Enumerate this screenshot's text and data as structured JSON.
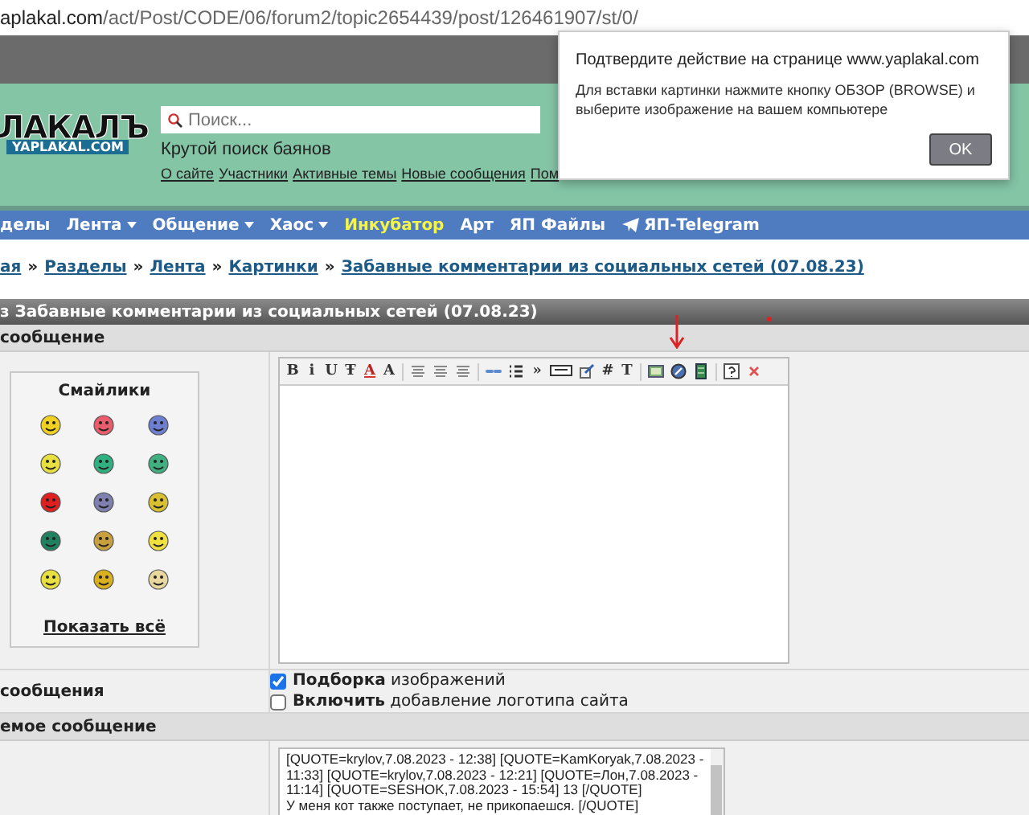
{
  "address_bar": {
    "host": "aplakal.com",
    "path": "/act/Post/CODE/06/forum2/topic2654439/post/126461907/st/0/"
  },
  "header": {
    "logo": {
      "title": "ЛАКАЛЪ",
      "domain": "YAPLAKAL.COM"
    },
    "search": {
      "placeholder": "Поиск..."
    },
    "tagline": "Крутой поиск баянов",
    "links": [
      "О сайте",
      "Участники",
      "Активные темы",
      "Новые сообщения",
      "Пом"
    ]
  },
  "nav": [
    {
      "label": "делы",
      "dropdown": false,
      "highlighted": false,
      "telegram": false
    },
    {
      "label": "Лента",
      "dropdown": true,
      "highlighted": false,
      "telegram": false
    },
    {
      "label": "Общение",
      "dropdown": true,
      "highlighted": false,
      "telegram": false
    },
    {
      "label": "Хаос",
      "dropdown": true,
      "highlighted": false,
      "telegram": false
    },
    {
      "label": "Инкубатор",
      "dropdown": false,
      "highlighted": true,
      "telegram": false
    },
    {
      "label": "Арт",
      "dropdown": false,
      "highlighted": false,
      "telegram": false
    },
    {
      "label": "ЯП Файлы",
      "dropdown": false,
      "highlighted": false,
      "telegram": false
    },
    {
      "label": "ЯП-Telegram",
      "dropdown": false,
      "highlighted": false,
      "telegram": true
    }
  ],
  "breadcrumbs": [
    "ая",
    "Разделы",
    "Лента",
    "Картинки",
    "Забавные комментарии из социальных сетей (07.08.23)"
  ],
  "breadcrumb_separator": "»",
  "topic_bar": "з Забавные комментарии из социальных сетей (07.08.23)",
  "section_header": "сообщение",
  "smilies": {
    "title": "Смайлики",
    "show_all": "Показать всё"
  },
  "toolbar": [
    {
      "kind": "glyph",
      "text": "B"
    },
    {
      "kind": "glyph",
      "text": "i"
    },
    {
      "kind": "glyph",
      "text": "U"
    },
    {
      "kind": "glyph",
      "text": "Ŧ"
    },
    {
      "kind": "color",
      "text": "A"
    },
    {
      "kind": "glyph",
      "text": "A"
    },
    {
      "kind": "sep"
    },
    {
      "kind": "align"
    },
    {
      "kind": "align"
    },
    {
      "kind": "align"
    },
    {
      "kind": "sep"
    },
    {
      "kind": "link"
    },
    {
      "kind": "list"
    },
    {
      "kind": "glyph",
      "text": "»"
    },
    {
      "kind": "hide"
    },
    {
      "kind": "edit"
    },
    {
      "kind": "glyph",
      "text": "#"
    },
    {
      "kind": "glyph",
      "text": "T"
    },
    {
      "kind": "sep"
    },
    {
      "kind": "image"
    },
    {
      "kind": "flash"
    },
    {
      "kind": "video"
    },
    {
      "kind": "sep"
    },
    {
      "kind": "help"
    },
    {
      "kind": "close"
    }
  ],
  "options": {
    "label": "сообщения",
    "checkboxes": [
      {
        "text": "**Подборка** изображений",
        "checked": true
      },
      {
        "text": "**Включить** добавление логотипа сайта",
        "checked": false
      }
    ]
  },
  "quoted_header": "емое сообщение",
  "quoted_message": [
    "[QUOTE=krylov,7.08.2023 - 12:38] [QUOTE=KamKoryak,7.08.2023 -",
    "11:33] [QUOTE=krylov,7.08.2023 - 12:21] [QUOTE=Лон,7.08.2023 -",
    "11:14] [QUOTE=SESHOK,7.08.2023 - 15:54] 13 [/QUOTE]",
    "У меня кот также поступает, не прикопаешся. [/QUOTE]"
  ],
  "dialog": {
    "title": "Подтвердите действие на странице www.yaplakal.com",
    "message": "Для вставки картинки нажмите кнопку ОБЗОР (BROWSE) и выберите изображение на вашем компьютере",
    "button": "OK"
  }
}
